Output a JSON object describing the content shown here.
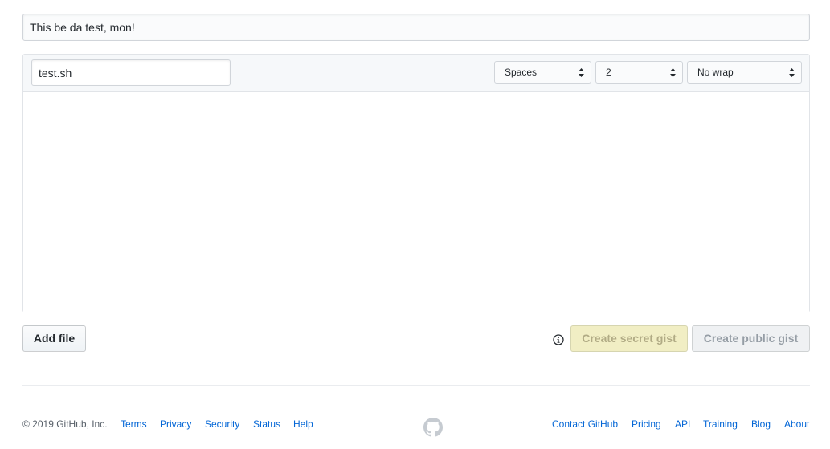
{
  "gist": {
    "description_value": "This be da test, mon!"
  },
  "file": {
    "filename_value": "test.sh",
    "indent_mode": "Spaces",
    "indent_size": "2",
    "wrap_mode": "No wrap"
  },
  "actions": {
    "add_file_label": "Add file",
    "create_secret_label": "Create secret gist",
    "create_public_label": "Create public gist",
    "info_icon": "info-icon"
  },
  "footer": {
    "copyright": "© 2019 GitHub, Inc.",
    "left_links": [
      "Terms",
      "Privacy",
      "Security",
      "Status",
      "Help"
    ],
    "right_links": [
      "Contact GitHub",
      "Pricing",
      "API",
      "Training",
      "Blog",
      "About"
    ],
    "logo_icon": "github-mark-icon"
  },
  "colors": {
    "link": "#0366d6",
    "secret_button_bg": "#f1eec4",
    "public_button_bg": "#eff1f3"
  }
}
